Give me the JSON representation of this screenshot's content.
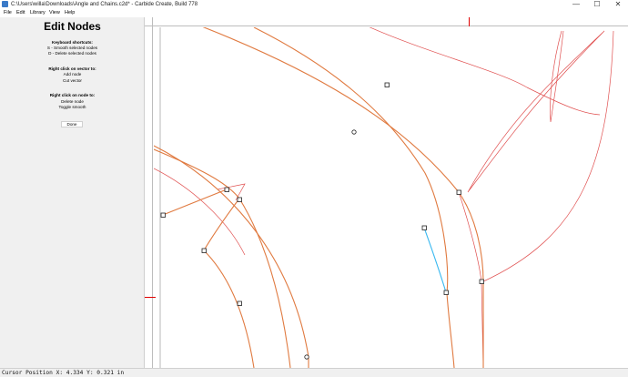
{
  "window": {
    "title": "C:\\Users\\willa\\Downloads\\Angle and Chains.c2d* - Carbide Create, Build 778",
    "minimize_glyph": "—",
    "maximize_glyph": "☐",
    "close_glyph": "✕"
  },
  "menu": {
    "items": [
      "File",
      "Edit",
      "Library",
      "View",
      "Help"
    ]
  },
  "panel": {
    "title": "Edit Nodes",
    "keyboard_heading": "Keyboard shortcuts:",
    "keyboard_items": [
      "S - Smooth selected nodes",
      "D - Delete selected nodes"
    ],
    "vector_heading": "Right click on vector to:",
    "vector_items": [
      "Add node",
      "Cut vector"
    ],
    "node_heading": "Right click on node to:",
    "node_items": [
      "Delete node",
      "Toggle smooth"
    ],
    "done_label": "Done"
  },
  "colors": {
    "curve_red": "#e05050",
    "curve_orange": "#e07a40",
    "selected_segment": "#38b8f0",
    "node_outline": "#222222",
    "cursor_marker": "#e00000"
  },
  "status": {
    "cursor_position": "Cursor Position X: 4.334 Y: 0.321 in"
  }
}
